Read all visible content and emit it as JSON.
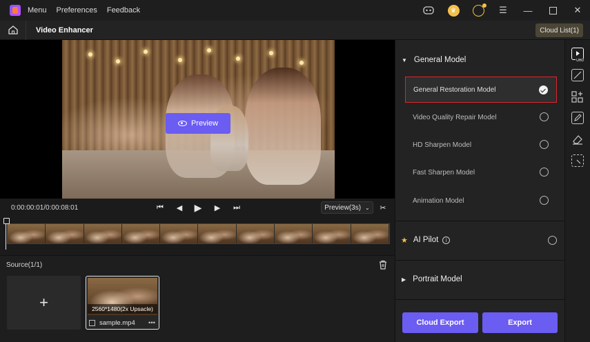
{
  "titlebar": {
    "menu_items": [
      "Menu",
      "Preferences",
      "Feedback"
    ]
  },
  "toolbar": {
    "title": "Video Enhancer",
    "cloud_list": "Cloud List(1)"
  },
  "player": {
    "preview_button": "Preview",
    "timecode": "0:00:00:01/0:00:08:01",
    "preview_duration": "Preview(3s)"
  },
  "source": {
    "label": "Source(1/1)",
    "add_symbol": "+",
    "clip": {
      "resolution": "2560*1480(2x Upsacle)",
      "filename": "sample.mp4",
      "more": "•••"
    }
  },
  "models": {
    "general_group": "General Model",
    "general_items": [
      {
        "label": "General Restoration Model",
        "selected": true
      },
      {
        "label": "Video Quality Repair Model",
        "selected": false
      },
      {
        "label": "HD Sharpen Model",
        "selected": false
      },
      {
        "label": "Fast Sharpen Model",
        "selected": false
      },
      {
        "label": "Animation Model",
        "selected": false
      }
    ],
    "ai_pilot": "AI Pilot",
    "portrait_group": "Portrait Model"
  },
  "actions": {
    "cloud_export": "Cloud Export",
    "export": "Export"
  },
  "tool_rail": {
    "uhd_badge": "UHD"
  },
  "colors": {
    "accent": "#6b5cf2",
    "selected_outline": "#e0252e",
    "crown": "#f3c04a"
  }
}
